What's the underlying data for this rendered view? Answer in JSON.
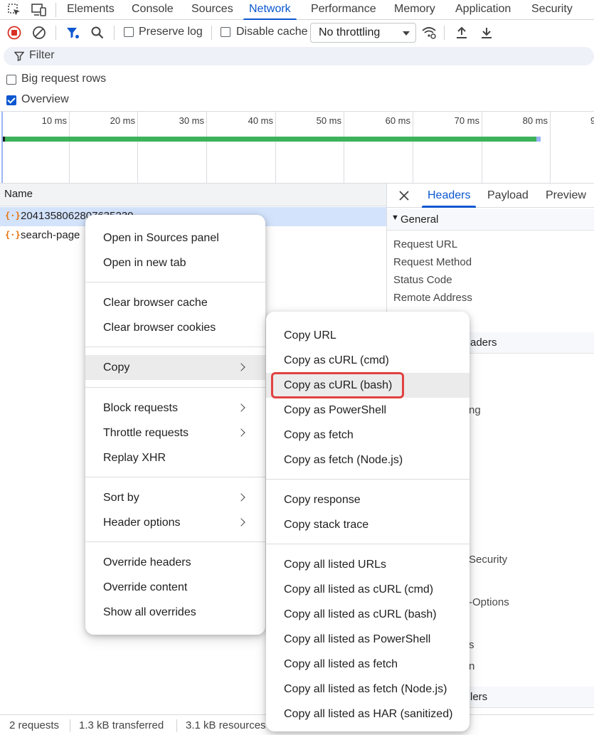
{
  "devtools": {
    "tabs": [
      "Elements",
      "Console",
      "Sources",
      "Network",
      "Performance",
      "Memory",
      "Application",
      "Security"
    ],
    "active_tab": "Network"
  },
  "toolbar": {
    "preserve_log": "Preserve log",
    "disable_cache": "Disable cache",
    "throttling": "No throttling"
  },
  "filter": {
    "placeholder": "Filter"
  },
  "settings": {
    "big_request_rows": "Big request rows",
    "overview": "Overview",
    "big_request_rows_checked": false,
    "overview_checked": true
  },
  "timeline": {
    "ticks": [
      "10 ms",
      "20 ms",
      "30 ms",
      "40 ms",
      "50 ms",
      "60 ms",
      "70 ms",
      "80 ms",
      "9"
    ]
  },
  "request_list": {
    "column_name": "Name",
    "rows": [
      {
        "name": "2041358062807635230",
        "selected": true
      },
      {
        "name": "search-page",
        "selected": false
      }
    ]
  },
  "detail_panel": {
    "tabs": [
      "Headers",
      "Payload",
      "Preview"
    ],
    "active_tab": "Headers",
    "general_section": "General",
    "general_fields": [
      "Request URL",
      "Request Method",
      "Status Code",
      "Remote Address"
    ],
    "visible_fragments": [
      "aders",
      "ng",
      "Security",
      "-Options",
      "s",
      "n",
      "lers"
    ]
  },
  "status_bar": {
    "requests": "2 requests",
    "transferred": "1.3 kB transferred",
    "resources": "3.1 kB resources"
  },
  "context_menu": {
    "groups": [
      [
        {
          "label": "Open in Sources panel"
        },
        {
          "label": "Open in new tab"
        }
      ],
      [
        {
          "label": "Clear browser cache"
        },
        {
          "label": "Clear browser cookies"
        }
      ],
      [
        {
          "label": "Copy",
          "submenu": true
        }
      ],
      [
        {
          "label": "Block requests",
          "submenu": true
        },
        {
          "label": "Throttle requests",
          "submenu": true
        },
        {
          "label": "Replay XHR"
        }
      ],
      [
        {
          "label": "Sort by",
          "submenu": true
        },
        {
          "label": "Header options",
          "submenu": true
        }
      ],
      [
        {
          "label": "Override headers"
        },
        {
          "label": "Override content"
        },
        {
          "label": "Show all overrides"
        }
      ]
    ]
  },
  "copy_submenu": {
    "groups": [
      [
        "Copy URL",
        "Copy as cURL (cmd)",
        "Copy as cURL (bash)",
        "Copy as PowerShell",
        "Copy as fetch",
        "Copy as fetch (Node.js)"
      ],
      [
        "Copy response",
        "Copy stack trace"
      ],
      [
        "Copy all listed URLs",
        "Copy all listed as cURL (cmd)",
        "Copy all listed as cURL (bash)",
        "Copy all listed as PowerShell",
        "Copy all listed as fetch",
        "Copy all listed as fetch (Node.js)",
        "Copy all listed as HAR (sanitized)"
      ]
    ],
    "highlighted": "Copy as cURL (bash)"
  },
  "colors": {
    "accent": "#0b57d0",
    "record_red": "#d93025",
    "highlight_box": "#e24141",
    "timeline_bar": "#3cb25b",
    "xhr_icon": "#e8710a"
  }
}
